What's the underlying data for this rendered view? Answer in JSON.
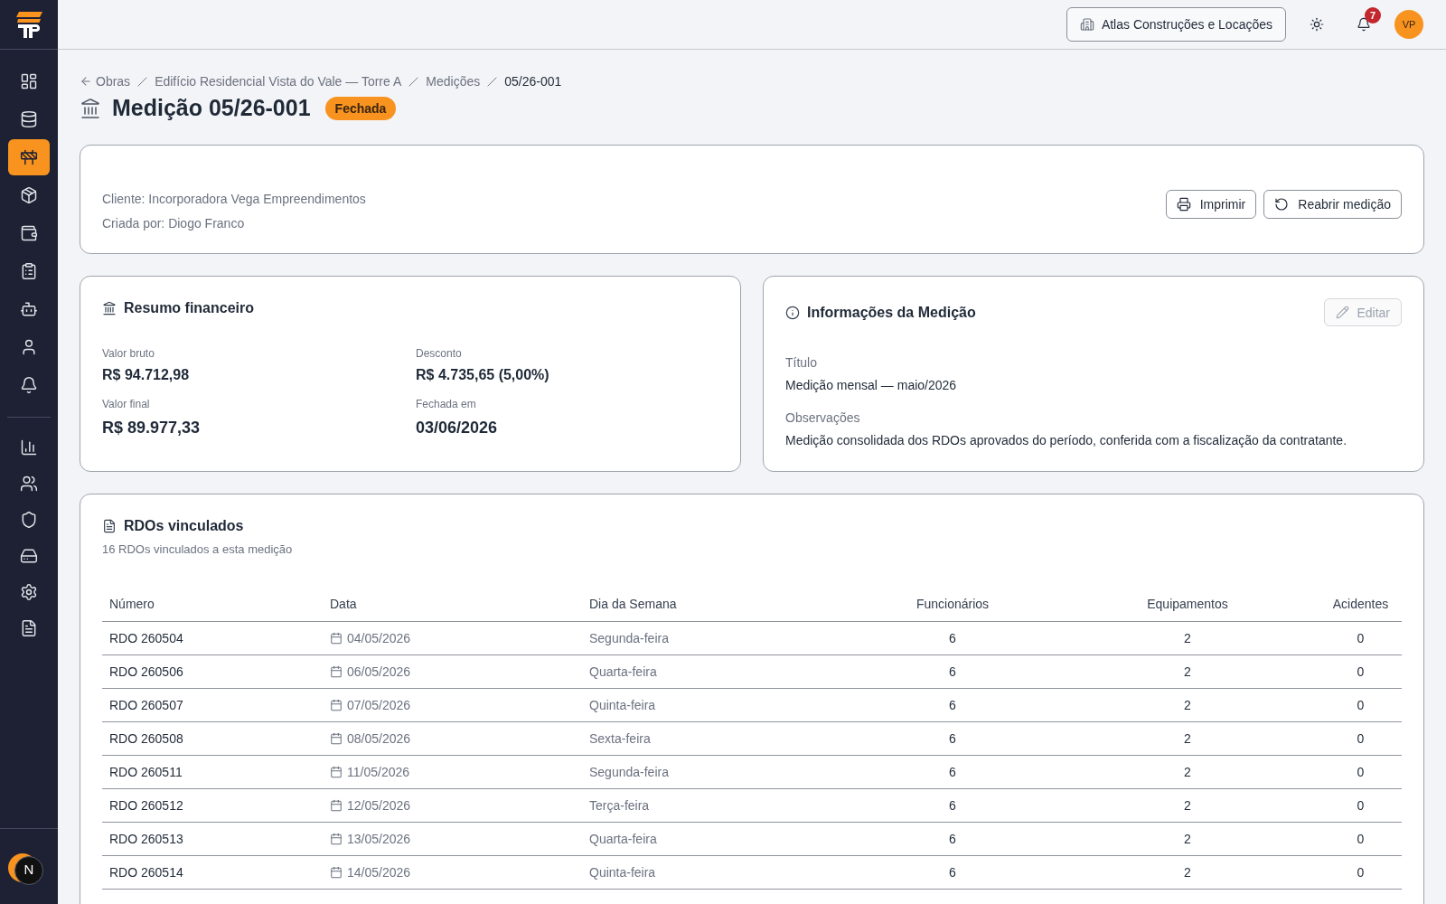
{
  "sidebar": {
    "groups": [
      {
        "items": [
          {
            "selected": false
          },
          {
            "selected": false
          },
          {
            "selected": true
          },
          {
            "selected": false
          },
          {
            "selected": false
          },
          {
            "selected": false
          },
          {
            "selected": false
          },
          {
            "selected": false
          },
          {
            "selected": false
          }
        ]
      },
      {
        "items": [
          {
            "selected": false
          },
          {
            "selected": false
          },
          {
            "selected": false
          },
          {
            "selected": false
          },
          {
            "selected": false
          },
          {
            "selected": false
          }
        ]
      }
    ],
    "dev_tools_badge": "N"
  },
  "header": {
    "company": "Atlas Construções e Locações",
    "notification_count": "7",
    "avatar_initials": "VP"
  },
  "breadcrumb": [
    {
      "label": "Obras",
      "current": false
    },
    {
      "label": "Edifício Residencial Vista do Vale — Torre A",
      "current": false
    },
    {
      "label": "Medições",
      "current": false
    },
    {
      "label": "05/26-001",
      "current": true
    }
  ],
  "page": {
    "title": "Medição 05/26-001",
    "status": "Fechada"
  },
  "summary": {
    "lines": [
      "Cliente: Incorporadora Vega Empreendimentos",
      "Criada por: Diogo Franco"
    ],
    "actions": [
      {
        "label": "Imprimir"
      },
      {
        "label": "Reabrir medição"
      }
    ]
  },
  "financial": {
    "title": "Resumo financeiro",
    "fields": [
      {
        "label": "Valor bruto",
        "value": "R$ 94.712,98",
        "large": false
      },
      {
        "label": "Desconto",
        "value": "R$ 4.735,65 (5,00%)",
        "large": false
      },
      {
        "label": "Valor final",
        "value": "R$ 89.977,33",
        "large": true
      },
      {
        "label": "Fechada em",
        "value": "03/06/2026",
        "large": true
      }
    ]
  },
  "info": {
    "title": "Informações da Medição",
    "edit_button": {
      "label": "Editar",
      "disabled": true
    },
    "fields": [
      {
        "label": "Título",
        "value": "Medição mensal — maio/2026"
      },
      {
        "label": "Observações",
        "value": "Medição consolidada dos RDOs aprovados do período, conferida com a fiscalização da contratante."
      }
    ]
  },
  "rdos": {
    "title": "RDOs vinculados",
    "subtitle": "16 RDOs vinculados a esta medição",
    "table": {
      "columns": [
        {
          "label": "Número",
          "kind": "id"
        },
        {
          "label": "Data",
          "kind": "date"
        },
        {
          "label": "Dia da Semana",
          "kind": "label"
        },
        {
          "label": "Funcionários",
          "kind": "count"
        },
        {
          "label": "Equipamentos",
          "kind": "count"
        },
        {
          "label": "Acidentes",
          "kind": "count"
        }
      ],
      "rows": [
        {
          "cells": [
            "RDO 260504",
            "04/05/2026",
            "Segunda-feira",
            "6",
            "2",
            "0"
          ]
        },
        {
          "cells": [
            "RDO 260506",
            "06/05/2026",
            "Quarta-feira",
            "6",
            "2",
            "0"
          ]
        },
        {
          "cells": [
            "RDO 260507",
            "07/05/2026",
            "Quinta-feira",
            "6",
            "2",
            "0"
          ]
        },
        {
          "cells": [
            "RDO 260508",
            "08/05/2026",
            "Sexta-feira",
            "6",
            "2",
            "0"
          ]
        },
        {
          "cells": [
            "RDO 260511",
            "11/05/2026",
            "Segunda-feira",
            "6",
            "2",
            "0"
          ]
        },
        {
          "cells": [
            "RDO 260512",
            "12/05/2026",
            "Terça-feira",
            "6",
            "2",
            "0"
          ]
        },
        {
          "cells": [
            "RDO 260513",
            "13/05/2026",
            "Quarta-feira",
            "6",
            "2",
            "0"
          ]
        },
        {
          "cells": [
            "RDO 260514",
            "14/05/2026",
            "Quinta-feira",
            "6",
            "2",
            "0"
          ]
        }
      ]
    }
  }
}
